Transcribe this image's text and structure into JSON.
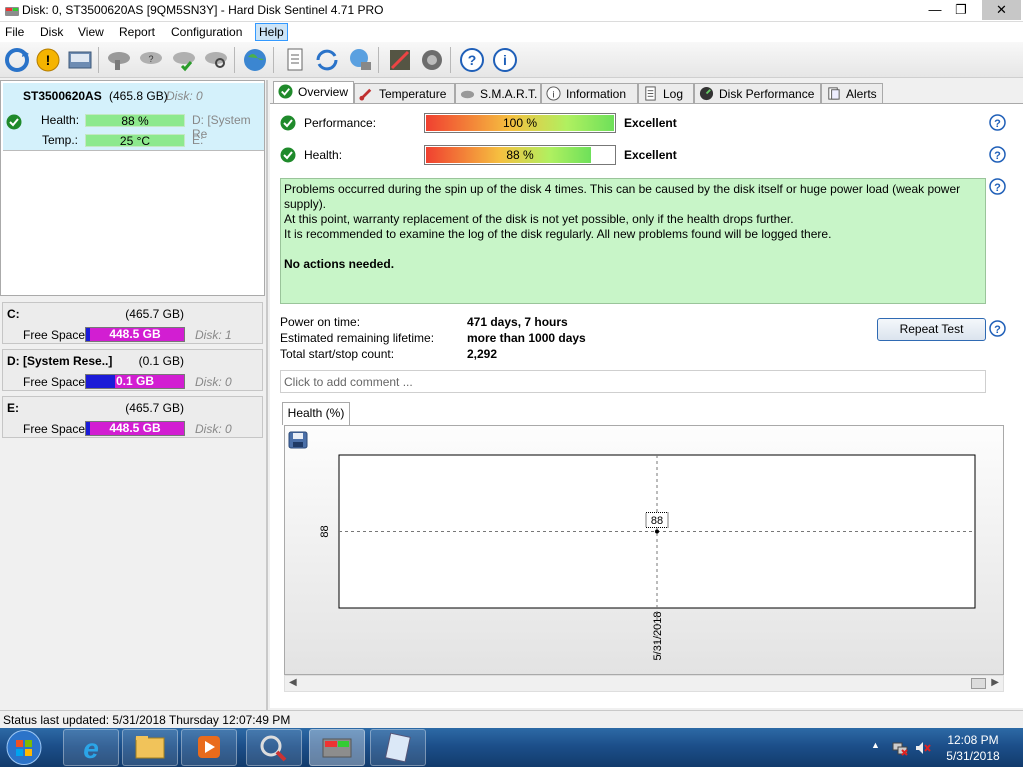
{
  "window": {
    "title": "Disk: 0, ST3500620AS [9QM5SN3Y]  -  Hard Disk Sentinel 4.71 PRO",
    "min_glyph": "—",
    "max_glyph": "❐",
    "close_glyph": "✕"
  },
  "menu": {
    "file": "File",
    "disk": "Disk",
    "view": "View",
    "report": "Report",
    "configuration": "Configuration",
    "help": "Help"
  },
  "disk_card": {
    "name": "ST3500620AS",
    "size": "(465.8 GB)",
    "disk_label": "Disk: 0",
    "health_label": "Health:",
    "health_value": "88 %",
    "temp_label": "Temp.:",
    "temp_value": "25 °C",
    "vol_d": "D: [System Re",
    "vol_e": "E:"
  },
  "volumes": [
    {
      "letter": "C:",
      "size": "(465.7 GB)",
      "free_label": "Free Space",
      "free_value": "448.5 GB",
      "used_fraction": 0.04,
      "disk": "Disk: 1"
    },
    {
      "letter": "D: [System Rese..]",
      "size": "(0.1 GB)",
      "free_label": "Free Space",
      "free_value": "0.1 GB",
      "used_fraction": 0.3,
      "disk": "Disk: 0"
    },
    {
      "letter": "E:",
      "size": "(465.7 GB)",
      "free_label": "Free Space",
      "free_value": "448.5 GB",
      "used_fraction": 0.04,
      "disk": "Disk: 0"
    }
  ],
  "tabs": [
    {
      "label": "Overview",
      "icon": "check-icon"
    },
    {
      "label": "Temperature",
      "icon": "thermometer-icon"
    },
    {
      "label": "S.M.A.R.T.",
      "icon": "disk-icon"
    },
    {
      "label": "Information",
      "icon": "info-icon"
    },
    {
      "label": "Log",
      "icon": "log-icon"
    },
    {
      "label": "Disk Performance",
      "icon": "gauge-icon"
    },
    {
      "label": "Alerts",
      "icon": "alert-icon"
    }
  ],
  "overview": {
    "performance_label": "Performance:",
    "performance_value": "100 %",
    "performance_fraction": 1.0,
    "performance_rating": "Excellent",
    "health_label": "Health:",
    "health_value": "88 %",
    "health_fraction": 0.88,
    "health_rating": "Excellent",
    "message": {
      "line1": "Problems occurred during the spin up of the disk 4 times. This can be caused by the disk itself or huge power load (weak power supply).",
      "line2": "At this point, warranty replacement of the disk is not yet possible, only if the health drops further.",
      "line3": "It is recommended to examine the log of the disk regularly. All new problems found will be logged there.",
      "line4": "No actions needed."
    },
    "power_on_label": "Power on time:",
    "power_on_value": "471 days, 7 hours",
    "lifetime_label": "Estimated remaining lifetime:",
    "lifetime_value": "more than 1000 days",
    "startstop_label": "Total start/stop count:",
    "startstop_value": "2,292",
    "repeat_button": "Repeat Test",
    "comment_placeholder": "Click to add comment ...",
    "health_tab": "Health (%)"
  },
  "chart_data": {
    "type": "line",
    "title": "",
    "x": [
      "5/31/2018"
    ],
    "series": [
      {
        "values": [
          88
        ]
      }
    ],
    "ylabel": "",
    "xlabel": "",
    "y_tick_labels": [
      "88"
    ],
    "x_tick_labels": [
      "5/31/2018"
    ],
    "data_labels": [
      "88"
    ],
    "grid": true
  },
  "statusbar": {
    "text": "Status last updated: 5/31/2018 Thursday 12:07:49 PM"
  },
  "taskbar": {
    "time": "12:08 PM",
    "date": "5/31/2018"
  }
}
